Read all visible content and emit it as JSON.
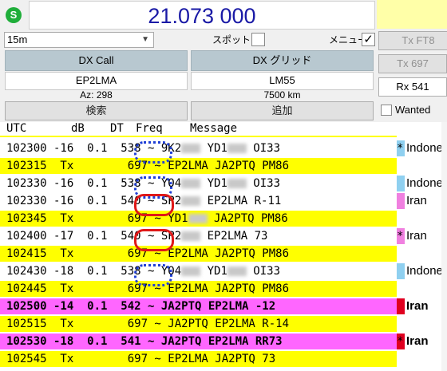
{
  "status_icon": "S",
  "frequency_display": "21.073 000",
  "band": {
    "selected": "15m"
  },
  "spot_label": "スポット",
  "menu_label": "メニュー",
  "menu_checked": "✓",
  "tx_mode_button": "Tx FT8",
  "tx_freq_button": "Tx  697",
  "rx_freq_button": "Rx  541",
  "wanted_label": "Wanted",
  "dx_call_label": "DX Call",
  "dx_grid_label": "DX グリッド",
  "dx_call_value": "EP2LMA",
  "dx_grid_value": "LM55",
  "azimuth": "Az: 298",
  "distance": "7500 km",
  "lookup_button": "検索",
  "add_button": "追加",
  "log_header": {
    "utc": "UTC",
    "db": "dB",
    "dt": "DT",
    "freq": "Freq",
    "message": "Message"
  },
  "rows": [
    {
      "text": "102300 -16  0.1  538 ~ 9K2▒▒ YD1▒▒▒ OI33",
      "pre": "102300 -16  0.1  538 ~ 9K2",
      "mid1": " YD1",
      "post": " OI33",
      "bar": "#ffffff",
      "tag": "#8fd0f0",
      "country": "Indonesia",
      "star": "*",
      "bold": false
    },
    {
      "pre": "102315  Tx        697 ~ EP2LMA JA2PTQ PM86",
      "bar": "#ffff00",
      "tag": "",
      "country": "",
      "star": "",
      "bold": false
    },
    {
      "pre": "102330 -16  0.1  538 ~ YO4",
      "mid1": " YD1",
      "post": " OI33",
      "bar": "#ffffff",
      "tag": "#8fd0f0",
      "country": "Indonesia",
      "star": "",
      "bold": false
    },
    {
      "pre": "102330 -16  0.1  540 ~ SP2",
      "mid1": " EP2LMA R-11",
      "post": "",
      "bar": "#ffffff",
      "tag": "#f080e0",
      "country": "Iran",
      "star": "",
      "bold": false,
      "blur_once": true
    },
    {
      "pre": "102345  Tx        697 ~ YD1",
      "mid1": " JA2PTQ PM86",
      "post": "",
      "bar": "#ffff00",
      "tag": "",
      "country": "",
      "star": "",
      "bold": false,
      "blur_once": true
    },
    {
      "pre": "102400 -17  0.1  540 ~ SP2",
      "mid1": " EP2LMA 73",
      "post": "",
      "bar": "#ffffff",
      "tag": "#f080e0",
      "country": "Iran",
      "star": "*",
      "bold": false,
      "blur_once": true
    },
    {
      "pre": "102415  Tx        697 ~ EP2LMA JA2PTQ PM86",
      "bar": "#ffff00",
      "tag": "",
      "country": "",
      "star": "",
      "bold": false
    },
    {
      "pre": "102430 -18  0.1  538 ~ YO4",
      "mid1": " YD1",
      "post": " OI33",
      "bar": "#ffffff",
      "tag": "#8fd0f0",
      "country": "Indonesia",
      "star": "",
      "bold": false
    },
    {
      "pre": "102445  Tx        697 ~ EP2LMA JA2PTQ PM86",
      "bar": "#ffff00",
      "tag": "",
      "country": "",
      "star": "",
      "bold": false
    },
    {
      "pre": "102500 -14  0.1  542 ~ JA2PTQ EP2LMA -12",
      "bar": "#ff66ff",
      "tag": "#e00020",
      "country": "Iran",
      "star": "",
      "bold": true
    },
    {
      "pre": "102515  Tx        697 ~ JA2PTQ EP2LMA R-14",
      "bar": "#ffff00",
      "tag": "",
      "country": "",
      "star": "",
      "bold": false
    },
    {
      "pre": "102530 -18  0.1  541 ~ JA2PTQ EP2LMA RR73",
      "bar": "#ff66ff",
      "tag": "#e00020",
      "country": "Iran",
      "star": "*",
      "bold": true
    },
    {
      "pre": "102545  Tx        697 ~ EP2LMA JA2PTQ 73",
      "bar": "#ffff00",
      "tag": "",
      "country": "",
      "star": "",
      "bold": false
    }
  ],
  "colors": {
    "freq_text": "#1a1aa6",
    "tx_row": "#ffff00",
    "new_dxcc_row": "#ff66ff",
    "annotation_blue": "#1f3fd6",
    "annotation_red": "#e01818"
  }
}
